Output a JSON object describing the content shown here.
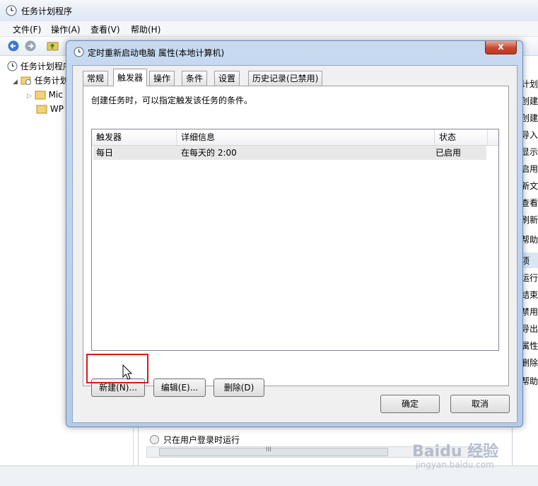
{
  "main_window": {
    "title": "任务计划程序",
    "menu": [
      "文件(F)",
      "操作(A)",
      "查看(V)",
      "帮助(H)"
    ],
    "tree": {
      "root": "任务计划程序",
      "library": "任务计划",
      "child_1": "Mic",
      "child_2": "WP"
    },
    "actions_pane": {
      "items": [
        "计划",
        "创建",
        "创建",
        "导入",
        "显示",
        "启用",
        "新文",
        "查看",
        "刷新",
        "帮助",
        "项",
        "运行",
        "结束",
        "禁用",
        "导出",
        "属性",
        "删除",
        "帮助"
      ]
    },
    "background_text": {
      "user_login_option": "只在用户登录时运行",
      "scroll_marker": "III"
    }
  },
  "dialog": {
    "title": "定时重新启动电脑 属性(本地计算机)",
    "close_glyph": "x",
    "tabs": [
      "常规",
      "触发器",
      "操作",
      "条件",
      "设置",
      "历史记录(已禁用)"
    ],
    "active_tab_index": 1,
    "description": "创建任务时，可以指定触发该任务的条件。",
    "trigger_table": {
      "columns": [
        "触发器",
        "详细信息",
        "状态"
      ],
      "rows": [
        {
          "trigger": "每日",
          "details": "在每天的 2:00",
          "status": "已启用"
        }
      ]
    },
    "buttons": {
      "new": "新建(N)...",
      "edit": "编辑(E)...",
      "delete": "删除(D)",
      "ok": "确定",
      "cancel": "取消"
    }
  },
  "watermark": {
    "brand": "Baidu 经验",
    "url": "jingyan.baidu.com"
  }
}
